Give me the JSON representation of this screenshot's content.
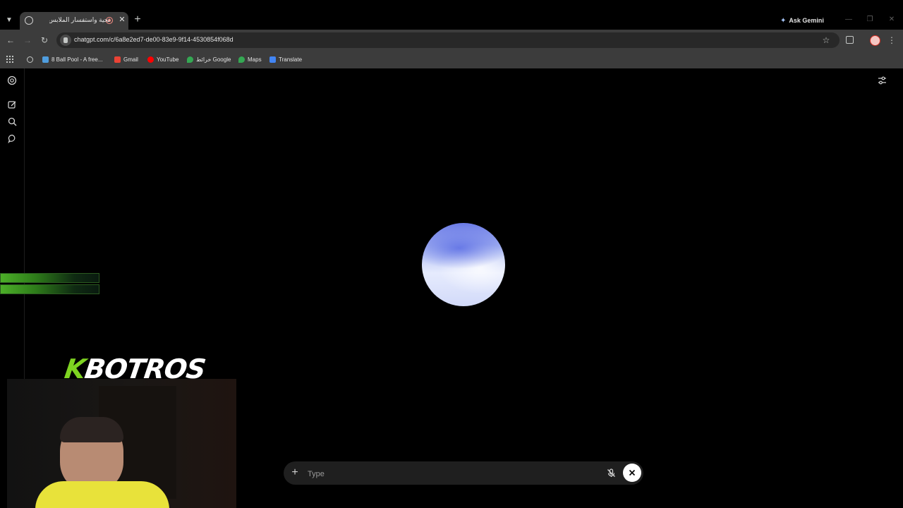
{
  "browser": {
    "tab": {
      "title": "تحية واستفسار الملابس"
    },
    "ask_gemini": "Ask Gemini",
    "url": "chatgpt.com/c/6a8e2ed7-de00-83e9-9f14-4530854f068d",
    "bookmarks": [
      {
        "label": "8 Ball Pool - A free...",
        "icon": "8ball-icon",
        "color": "#4f9dde"
      },
      {
        "label": "Gmail",
        "icon": "gmail-icon",
        "color": "#ea4335"
      },
      {
        "label": "YouTube",
        "icon": "youtube-icon",
        "color": "#ff0000"
      },
      {
        "label": "خرائط Google",
        "icon": "maps-icon",
        "color": "#34a853"
      },
      {
        "label": "Maps",
        "icon": "maps-icon",
        "color": "#34a853"
      },
      {
        "label": "Translate",
        "icon": "translate-icon",
        "color": "#4285f4"
      }
    ]
  },
  "sidebar": {
    "items": [
      {
        "icon": "openai-logo-icon"
      },
      {
        "icon": "new-chat-icon"
      },
      {
        "icon": "search-icon"
      },
      {
        "icon": "chat-bubble-icon"
      }
    ]
  },
  "voice": {
    "orb_colors": [
      "#6a7ae6",
      "#b7c4f5",
      "#e6ebfd"
    ]
  },
  "composer": {
    "placeholder": "Type"
  },
  "overlay": {
    "watermark_k": "K",
    "watermark_name": "BOTROS"
  },
  "colors": {
    "accent_green": "#7ed321",
    "toolbar_bg": "#3c3c3c",
    "page_bg": "#000000"
  }
}
